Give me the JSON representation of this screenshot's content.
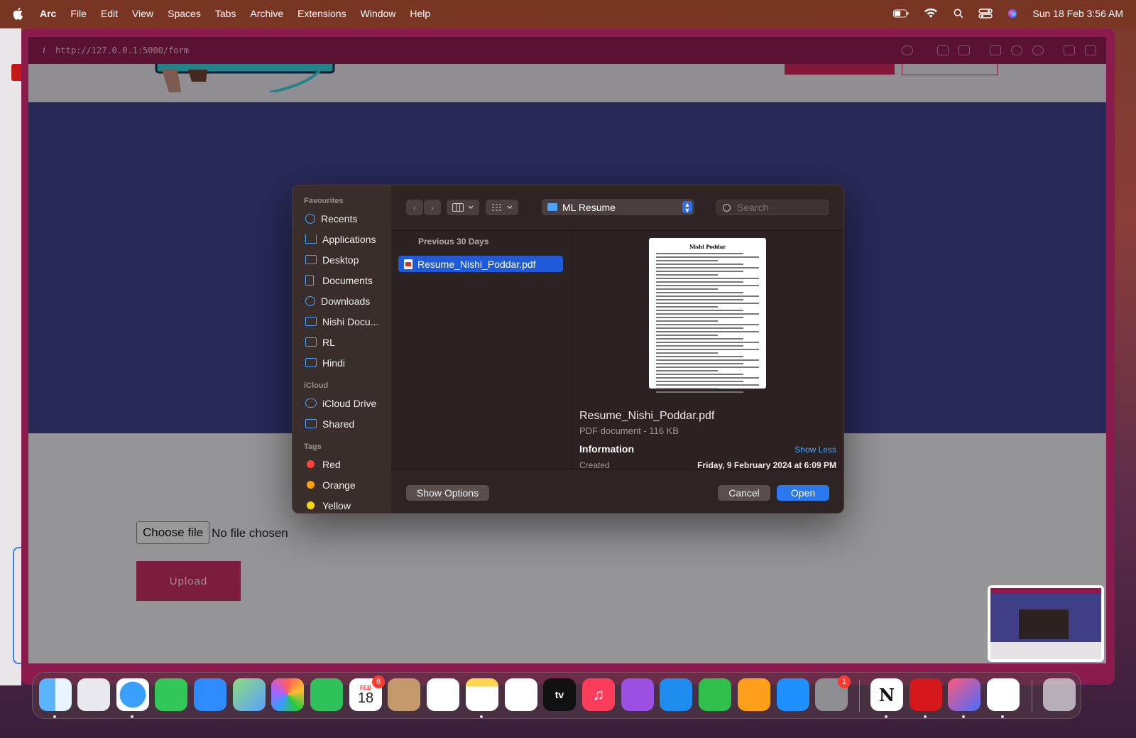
{
  "menubar": {
    "app_name": "Arc",
    "items": [
      "File",
      "Edit",
      "View",
      "Spaces",
      "Tabs",
      "Archive",
      "Extensions",
      "Window",
      "Help"
    ],
    "clock": "Sun 18 Feb  3:56 AM"
  },
  "browser": {
    "info_glyph": "i",
    "url": "http://127.0.0.1:5000/form"
  },
  "page": {
    "choose_file_label": "Choose file",
    "no_file_text": "No file chosen",
    "upload_label": "Upload"
  },
  "dialog": {
    "sidebar": {
      "favourites_heading": "Favourites",
      "favourites": [
        "Recents",
        "Applications",
        "Desktop",
        "Documents",
        "Downloads",
        "Nishi Docu...",
        "RL",
        "Hindi"
      ],
      "icloud_heading": "iCloud",
      "icloud": [
        "iCloud Drive",
        "Shared"
      ],
      "tags_heading": "Tags",
      "tags": [
        {
          "label": "Red",
          "color": "#ff453a"
        },
        {
          "label": "Orange",
          "color": "#ff9f0a"
        },
        {
          "label": "Yellow",
          "color": "#ffd60a"
        }
      ]
    },
    "toolbar": {
      "location": "ML Resume",
      "search_placeholder": "Search"
    },
    "list": {
      "heading": "Previous 30 Days",
      "selected_file": "Resume_Nishi_Poddar.pdf"
    },
    "preview": {
      "thumb_title": "Nishi Poddar",
      "file_name": "Resume_Nishi_Poddar.pdf",
      "kind": "PDF document - 116 KB",
      "info_heading": "Information",
      "show_less": "Show Less",
      "created_label": "Created",
      "created_value": "Friday, 9 February 2024 at 6:09 PM"
    },
    "footer": {
      "show_options": "Show Options",
      "cancel": "Cancel",
      "open": "Open"
    }
  },
  "dock": {
    "calendar_month": "FEB",
    "calendar_day": "18",
    "calendar_badge": "6",
    "settings_badge": "1",
    "notion_letter": "N"
  }
}
